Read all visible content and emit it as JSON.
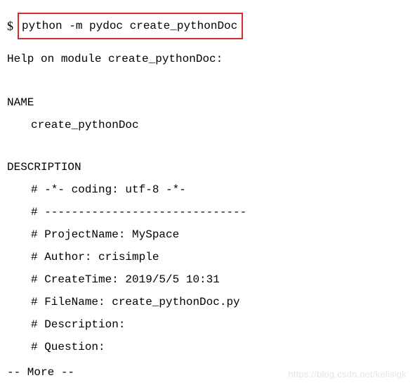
{
  "prompt": {
    "symbol": "$",
    "command": "python -m pydoc create_pythonDoc"
  },
  "help_intro": "Help on module create_pythonDoc:",
  "name_section": {
    "header": "NAME",
    "value": "create_pythonDoc"
  },
  "description_section": {
    "header": "DESCRIPTION",
    "lines": [
      "# -*- coding: utf-8 -*-",
      "# ------------------------------",
      "# ProjectName: MySpace",
      "# Author: crisimple",
      "# CreateTime: 2019/5/5 10:31",
      "# FileName: create_pythonDoc.py",
      "# Description:",
      "# Question:"
    ]
  },
  "more_prompt": "-- More  --",
  "watermark": "https://blog.csdn.net/kelisigk"
}
